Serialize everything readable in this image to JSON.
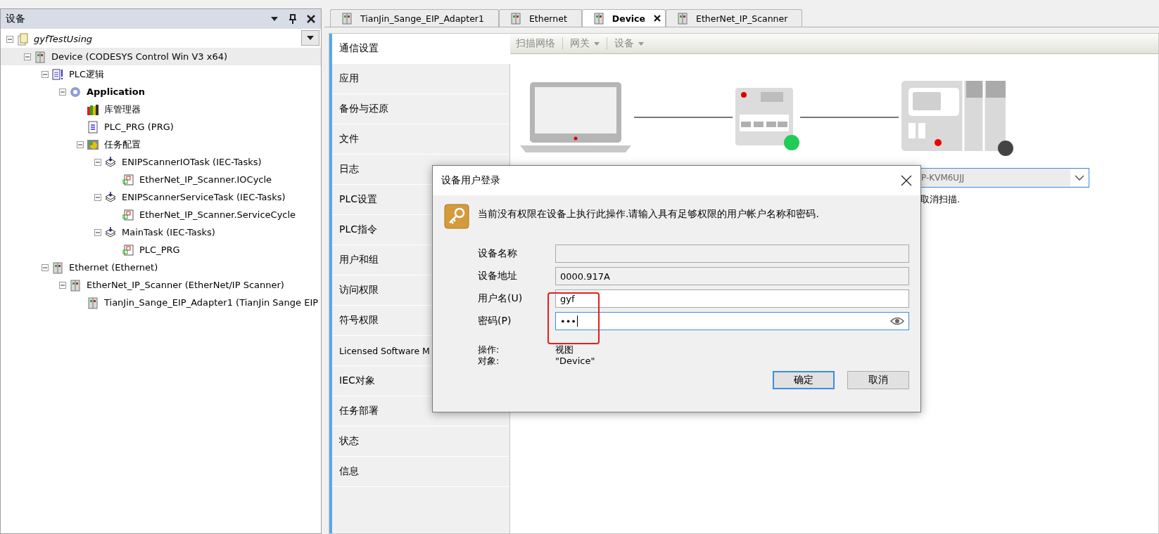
{
  "tree_panel": {
    "title": "设备"
  },
  "tree": [
    {
      "label": "gyfTestUsing",
      "kind": "project",
      "expanded": true,
      "selected": false,
      "children": [
        {
          "label": "Device (CODESYS Control Win V3 x64)",
          "kind": "device",
          "expanded": true,
          "selected": true,
          "children": [
            {
              "label": "PLC逻辑",
              "kind": "plc-logic",
              "expanded": true,
              "selected": false,
              "children": [
                {
                  "label": "Application",
                  "kind": "application",
                  "expanded": true,
                  "selected": false,
                  "children": [
                    {
                      "label": "库管理器",
                      "kind": "library",
                      "selected": false
                    },
                    {
                      "label": "PLC_PRG (PRG)",
                      "kind": "pou",
                      "selected": false
                    },
                    {
                      "label": "任务配置",
                      "kind": "task-config",
                      "expanded": true,
                      "selected": false,
                      "children": [
                        {
                          "label": "ENIPScannerIOTask (IEC-Tasks)",
                          "kind": "task",
                          "expanded": true,
                          "selected": false,
                          "children": [
                            {
                              "label": "EtherNet_IP_Scanner.IOCycle",
                              "kind": "call",
                              "selected": false
                            }
                          ]
                        },
                        {
                          "label": "ENIPScannerServiceTask (IEC-Tasks)",
                          "kind": "task",
                          "expanded": true,
                          "selected": false,
                          "children": [
                            {
                              "label": "EtherNet_IP_Scanner.ServiceCycle",
                              "kind": "call",
                              "selected": false
                            }
                          ]
                        },
                        {
                          "label": "MainTask (IEC-Tasks)",
                          "kind": "task",
                          "expanded": true,
                          "selected": false,
                          "children": [
                            {
                              "label": "PLC_PRG",
                              "kind": "call",
                              "selected": false
                            }
                          ]
                        }
                      ]
                    }
                  ]
                }
              ]
            },
            {
              "label": "Ethernet (Ethernet)",
              "kind": "device",
              "expanded": true,
              "selected": false,
              "children": [
                {
                  "label": "EtherNet_IP_Scanner (EtherNet/IP Scanner)",
                  "kind": "device",
                  "expanded": true,
                  "selected": false,
                  "children": [
                    {
                      "label": "TianJin_Sange_EIP_Adapter1 (TianJin Sange EIP",
                      "kind": "device",
                      "selected": false
                    }
                  ]
                }
              ]
            }
          ]
        }
      ]
    }
  ],
  "tabs": [
    {
      "label": "TianJin_Sange_EIP_Adapter1",
      "selected": false
    },
    {
      "label": "Ethernet",
      "selected": false
    },
    {
      "label": "Device",
      "selected": true
    },
    {
      "label": "EtherNet_IP_Scanner",
      "selected": false
    }
  ],
  "side_nav": [
    {
      "label": "通信设置",
      "selected": true
    },
    {
      "label": "应用",
      "selected": false
    },
    {
      "label": "备份与还原",
      "selected": false
    },
    {
      "label": "文件",
      "selected": false
    },
    {
      "label": "日志",
      "selected": false
    },
    {
      "label": "PLC设置",
      "selected": false
    },
    {
      "label": "PLC指令",
      "selected": false
    },
    {
      "label": "用户和组",
      "selected": false
    },
    {
      "label": "访问权限",
      "selected": false
    },
    {
      "label": "符号权限",
      "selected": false
    },
    {
      "label": "Licensed Software M",
      "selected": false
    },
    {
      "label": "IEC对象",
      "selected": false
    },
    {
      "label": "任务部署",
      "selected": false
    },
    {
      "label": "状态",
      "selected": false
    },
    {
      "label": "信息",
      "selected": false
    }
  ],
  "toolbar": [
    {
      "label": "扫描网络",
      "kind": "button",
      "disabled": true
    },
    {
      "label": "网关",
      "kind": "menu",
      "disabled": true
    },
    {
      "label": "设备",
      "kind": "menu",
      "disabled": true
    }
  ],
  "topology": [
    {
      "kind": "computer"
    },
    {
      "kind": "gateway",
      "color": "#1fcc55"
    },
    {
      "kind": "controller",
      "color": "#444444"
    }
  ],
  "device_select": {
    "value": "P-KVM6UJJ"
  },
  "scan_note": "取消扫描.",
  "dialog": {
    "title": "设备用户登录",
    "message": "当前没有权限在设备上执行此操作.请输入具有足够权限的用户帐户名称和密码.",
    "fields": [
      {
        "label": "设备名称",
        "kind": "text",
        "disabled": true,
        "focused": false
      },
      {
        "label": "设备地址",
        "kind": "text",
        "value": "0000.917A",
        "disabled": true,
        "focused": false
      },
      {
        "label": "用户名(U)",
        "kind": "text",
        "value": "gyf",
        "disabled": false,
        "focused": false
      },
      {
        "label": "密码(P)",
        "kind": "password",
        "value": "•••",
        "disabled": false,
        "focused": true
      }
    ],
    "info": [
      {
        "label": "操作:",
        "value": "视图"
      },
      {
        "label": "对象:",
        "value": "\"Device\""
      }
    ],
    "buttons": [
      {
        "label": "确定",
        "default": true
      },
      {
        "label": "取消",
        "default": false
      }
    ]
  }
}
